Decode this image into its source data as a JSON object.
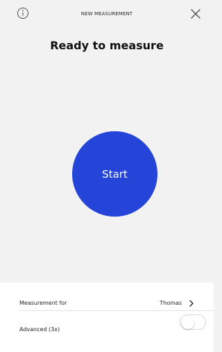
{
  "header": {
    "title": "NEW MEASUREMENT",
    "info_icon": "info-icon",
    "close_icon": "close-icon"
  },
  "main": {
    "title": "Ready to measure",
    "start_label": "Start",
    "accent_color": "#2545d8"
  },
  "settings": {
    "measurement_for_label": "Measurement for",
    "measurement_for_value": "Thomas",
    "advanced_label": "Advanced (3x)",
    "advanced_enabled": false,
    "chevron_icon": "chevron-right-icon"
  }
}
